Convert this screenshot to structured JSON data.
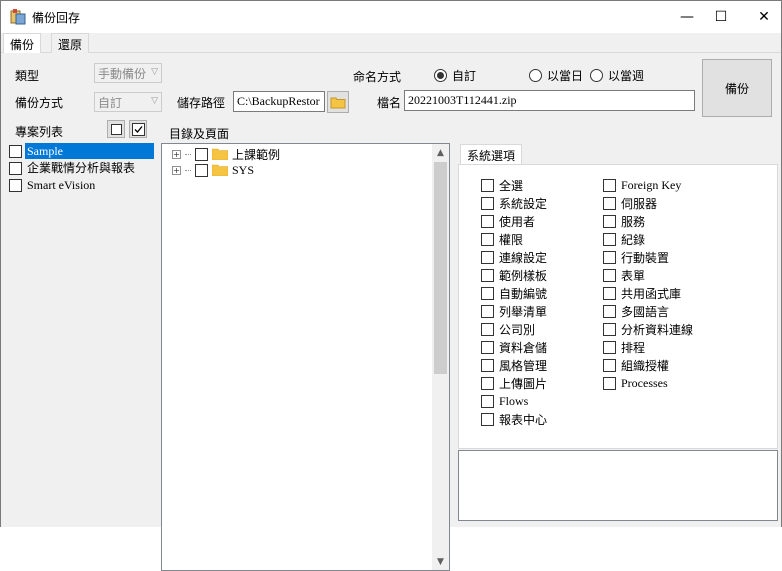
{
  "window": {
    "title": "備份回存",
    "minimize_glyph": "—",
    "maximize_glyph": "☐",
    "close_glyph": "✕"
  },
  "tabs": [
    {
      "label": "備份",
      "active": true
    },
    {
      "label": "還原",
      "active": false
    }
  ],
  "form": {
    "type_label": "類型",
    "type_value": "手動備份",
    "method_label": "備份方式",
    "method_value": "自訂",
    "path_label": "儲存路徑",
    "path_value": "C:\\BackupRestor",
    "naming_label": "命名方式",
    "naming_options": [
      "自訂",
      "以當日",
      "以當週"
    ],
    "naming_selected": "自訂",
    "filename_label": "檔名",
    "filename_value": "20221003T112441.zip",
    "backup_button": "備份"
  },
  "projects": {
    "label": "專案列表",
    "items": [
      {
        "label": "Sample",
        "selected": true
      },
      {
        "label": "企業戰情分析與報表",
        "selected": false
      },
      {
        "label": "Smart eVision",
        "selected": false
      }
    ]
  },
  "directory": {
    "label": "目錄及頁面",
    "items": [
      {
        "label": "上課範例"
      },
      {
        "label": "SYS"
      }
    ]
  },
  "system_options": {
    "tab_label": "系統選項",
    "left": [
      "全選",
      "系統設定",
      "使用者",
      "權限",
      "連線設定",
      "範例樣板",
      "自動編號",
      "列舉清單",
      "公司別",
      "資料倉儲",
      "風格管理",
      "上傳圖片",
      "Flows",
      "報表中心"
    ],
    "right": [
      "Foreign Key",
      "伺服器",
      "服務",
      "紀錄",
      "行動裝置",
      "表單",
      "共用函式庫",
      "多國語言",
      "分析資料連線",
      "排程",
      "組織授權",
      "Processes"
    ]
  },
  "colors": {
    "selection": "#0078d7",
    "folder": "#f6c443"
  }
}
